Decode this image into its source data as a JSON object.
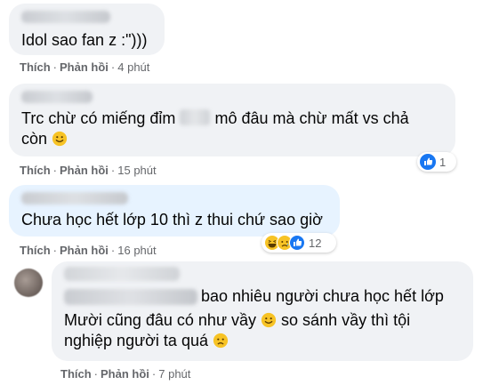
{
  "comments": [
    {
      "text": "Idol sao fan z :\")))",
      "actions": {
        "like": "Thích",
        "reply": "Phản hồi",
        "time": "4 phút"
      }
    },
    {
      "text_part1": "Trc chừ có miếng đỉm",
      "text_part2": "mô đâu mà chừ mất vs chả",
      "text_part3": "còn",
      "actions": {
        "like": "Thích",
        "reply": "Phản hồi",
        "time": "15 phút"
      },
      "reactions": {
        "icons": [
          "like-icon"
        ],
        "count": "1"
      }
    },
    {
      "text": "Chưa học hết lớp 10 thì z thui chứ sao giờ",
      "actions": {
        "like": "Thích",
        "reply": "Phản hồi",
        "time": "16 phút"
      },
      "reactions": {
        "icons": [
          "haha-icon",
          "sad-icon",
          "like-icon"
        ],
        "count": "12"
      }
    },
    {
      "line1": "bao nhiêu người chưa học hết lớp",
      "line2_a": "Mười cũng đâu có như vầy",
      "line2_b": "so sánh vầy thì tội",
      "line3": "nghiệp người ta quá",
      "actions": {
        "like": "Thích",
        "reply": "Phản hồi",
        "time": "7 phút"
      }
    }
  ],
  "colors": {
    "bubble": "#f0f2f5",
    "bubble_highlight": "#e7f3ff",
    "meta": "#65676b",
    "like_blue": "#1877f2"
  }
}
